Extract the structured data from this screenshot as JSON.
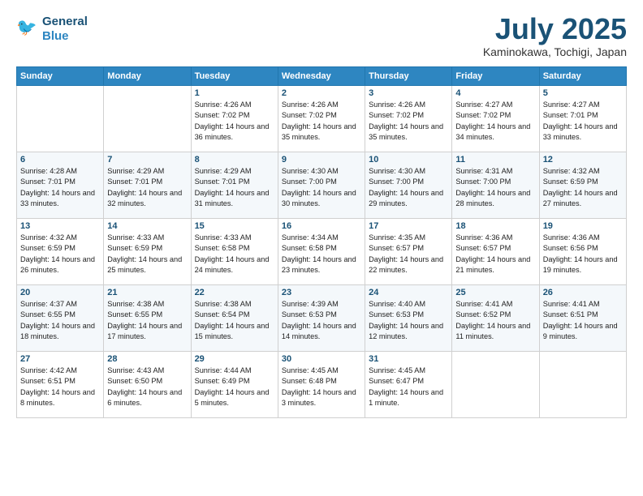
{
  "header": {
    "logo": {
      "line1": "General",
      "line2": "Blue"
    },
    "title": "July 2025",
    "location": "Kaminokawa, Tochigi, Japan"
  },
  "calendar": {
    "days_of_week": [
      "Sunday",
      "Monday",
      "Tuesday",
      "Wednesday",
      "Thursday",
      "Friday",
      "Saturday"
    ],
    "weeks": [
      [
        {
          "day": null
        },
        {
          "day": null
        },
        {
          "day": "1",
          "sunrise": "Sunrise: 4:26 AM",
          "sunset": "Sunset: 7:02 PM",
          "daylight": "Daylight: 14 hours and 36 minutes."
        },
        {
          "day": "2",
          "sunrise": "Sunrise: 4:26 AM",
          "sunset": "Sunset: 7:02 PM",
          "daylight": "Daylight: 14 hours and 35 minutes."
        },
        {
          "day": "3",
          "sunrise": "Sunrise: 4:26 AM",
          "sunset": "Sunset: 7:02 PM",
          "daylight": "Daylight: 14 hours and 35 minutes."
        },
        {
          "day": "4",
          "sunrise": "Sunrise: 4:27 AM",
          "sunset": "Sunset: 7:02 PM",
          "daylight": "Daylight: 14 hours and 34 minutes."
        },
        {
          "day": "5",
          "sunrise": "Sunrise: 4:27 AM",
          "sunset": "Sunset: 7:01 PM",
          "daylight": "Daylight: 14 hours and 33 minutes."
        }
      ],
      [
        {
          "day": "6",
          "sunrise": "Sunrise: 4:28 AM",
          "sunset": "Sunset: 7:01 PM",
          "daylight": "Daylight: 14 hours and 33 minutes."
        },
        {
          "day": "7",
          "sunrise": "Sunrise: 4:29 AM",
          "sunset": "Sunset: 7:01 PM",
          "daylight": "Daylight: 14 hours and 32 minutes."
        },
        {
          "day": "8",
          "sunrise": "Sunrise: 4:29 AM",
          "sunset": "Sunset: 7:01 PM",
          "daylight": "Daylight: 14 hours and 31 minutes."
        },
        {
          "day": "9",
          "sunrise": "Sunrise: 4:30 AM",
          "sunset": "Sunset: 7:00 PM",
          "daylight": "Daylight: 14 hours and 30 minutes."
        },
        {
          "day": "10",
          "sunrise": "Sunrise: 4:30 AM",
          "sunset": "Sunset: 7:00 PM",
          "daylight": "Daylight: 14 hours and 29 minutes."
        },
        {
          "day": "11",
          "sunrise": "Sunrise: 4:31 AM",
          "sunset": "Sunset: 7:00 PM",
          "daylight": "Daylight: 14 hours and 28 minutes."
        },
        {
          "day": "12",
          "sunrise": "Sunrise: 4:32 AM",
          "sunset": "Sunset: 6:59 PM",
          "daylight": "Daylight: 14 hours and 27 minutes."
        }
      ],
      [
        {
          "day": "13",
          "sunrise": "Sunrise: 4:32 AM",
          "sunset": "Sunset: 6:59 PM",
          "daylight": "Daylight: 14 hours and 26 minutes."
        },
        {
          "day": "14",
          "sunrise": "Sunrise: 4:33 AM",
          "sunset": "Sunset: 6:59 PM",
          "daylight": "Daylight: 14 hours and 25 minutes."
        },
        {
          "day": "15",
          "sunrise": "Sunrise: 4:33 AM",
          "sunset": "Sunset: 6:58 PM",
          "daylight": "Daylight: 14 hours and 24 minutes."
        },
        {
          "day": "16",
          "sunrise": "Sunrise: 4:34 AM",
          "sunset": "Sunset: 6:58 PM",
          "daylight": "Daylight: 14 hours and 23 minutes."
        },
        {
          "day": "17",
          "sunrise": "Sunrise: 4:35 AM",
          "sunset": "Sunset: 6:57 PM",
          "daylight": "Daylight: 14 hours and 22 minutes."
        },
        {
          "day": "18",
          "sunrise": "Sunrise: 4:36 AM",
          "sunset": "Sunset: 6:57 PM",
          "daylight": "Daylight: 14 hours and 21 minutes."
        },
        {
          "day": "19",
          "sunrise": "Sunrise: 4:36 AM",
          "sunset": "Sunset: 6:56 PM",
          "daylight": "Daylight: 14 hours and 19 minutes."
        }
      ],
      [
        {
          "day": "20",
          "sunrise": "Sunrise: 4:37 AM",
          "sunset": "Sunset: 6:55 PM",
          "daylight": "Daylight: 14 hours and 18 minutes."
        },
        {
          "day": "21",
          "sunrise": "Sunrise: 4:38 AM",
          "sunset": "Sunset: 6:55 PM",
          "daylight": "Daylight: 14 hours and 17 minutes."
        },
        {
          "day": "22",
          "sunrise": "Sunrise: 4:38 AM",
          "sunset": "Sunset: 6:54 PM",
          "daylight": "Daylight: 14 hours and 15 minutes."
        },
        {
          "day": "23",
          "sunrise": "Sunrise: 4:39 AM",
          "sunset": "Sunset: 6:53 PM",
          "daylight": "Daylight: 14 hours and 14 minutes."
        },
        {
          "day": "24",
          "sunrise": "Sunrise: 4:40 AM",
          "sunset": "Sunset: 6:53 PM",
          "daylight": "Daylight: 14 hours and 12 minutes."
        },
        {
          "day": "25",
          "sunrise": "Sunrise: 4:41 AM",
          "sunset": "Sunset: 6:52 PM",
          "daylight": "Daylight: 14 hours and 11 minutes."
        },
        {
          "day": "26",
          "sunrise": "Sunrise: 4:41 AM",
          "sunset": "Sunset: 6:51 PM",
          "daylight": "Daylight: 14 hours and 9 minutes."
        }
      ],
      [
        {
          "day": "27",
          "sunrise": "Sunrise: 4:42 AM",
          "sunset": "Sunset: 6:51 PM",
          "daylight": "Daylight: 14 hours and 8 minutes."
        },
        {
          "day": "28",
          "sunrise": "Sunrise: 4:43 AM",
          "sunset": "Sunset: 6:50 PM",
          "daylight": "Daylight: 14 hours and 6 minutes."
        },
        {
          "day": "29",
          "sunrise": "Sunrise: 4:44 AM",
          "sunset": "Sunset: 6:49 PM",
          "daylight": "Daylight: 14 hours and 5 minutes."
        },
        {
          "day": "30",
          "sunrise": "Sunrise: 4:45 AM",
          "sunset": "Sunset: 6:48 PM",
          "daylight": "Daylight: 14 hours and 3 minutes."
        },
        {
          "day": "31",
          "sunrise": "Sunrise: 4:45 AM",
          "sunset": "Sunset: 6:47 PM",
          "daylight": "Daylight: 14 hours and 1 minute."
        },
        {
          "day": null
        },
        {
          "day": null
        }
      ]
    ]
  }
}
